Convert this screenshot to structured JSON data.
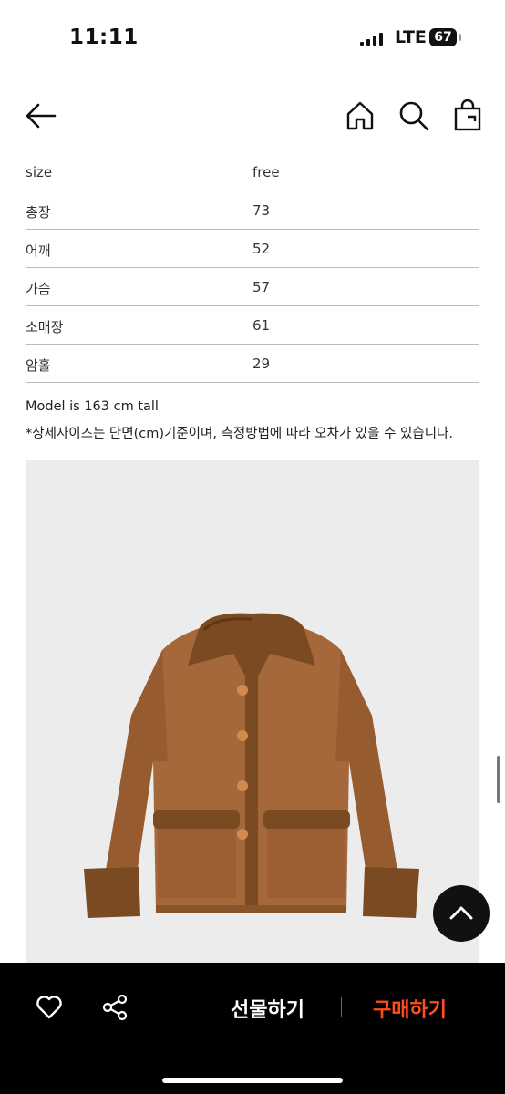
{
  "status_bar": {
    "time": "11:11",
    "network": "LTE",
    "battery": "67"
  },
  "nav": {
    "back_icon": "arrow-left-icon",
    "home_icon": "home-icon",
    "search_icon": "search-icon",
    "bag_icon": "shopping-bag-icon"
  },
  "size_table": {
    "header": {
      "label": "size",
      "value": "free"
    },
    "rows": [
      {
        "label": "총장",
        "value": "73"
      },
      {
        "label": "어깨",
        "value": "52"
      },
      {
        "label": "가슴",
        "value": "57"
      },
      {
        "label": "소매장",
        "value": "61"
      },
      {
        "label": "암홀",
        "value": "29"
      }
    ]
  },
  "notes": {
    "model": "Model is 163 cm tall",
    "measure": "*상세사이즈는 단면(cm)기준이며, 측정방법에 따라 오차가 있을 수 있습니다."
  },
  "bottom_bar": {
    "gift_label": "선물하기",
    "buy_label": "구매하기",
    "buy_color": "#ff4d1c"
  }
}
